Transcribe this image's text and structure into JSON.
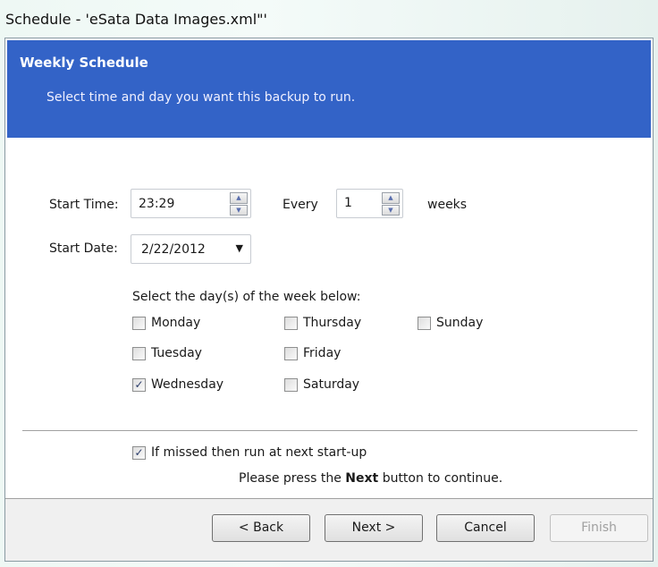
{
  "window": {
    "title": "Schedule -  'eSata Data Images.xml\"'"
  },
  "header": {
    "title": "Weekly Schedule",
    "subtitle": "Select time and day you want this backup to run."
  },
  "form": {
    "start_time_label": "Start Time:",
    "start_time_value": "23:29",
    "every_label": "Every",
    "every_value": "1",
    "weeks_label": "weeks",
    "start_date_label": "Start Date:",
    "start_date_value": "2/22/2012",
    "days_prompt": "Select the day(s) of the week below:",
    "days": [
      {
        "label": "Monday",
        "checked": false
      },
      {
        "label": "Tuesday",
        "checked": false
      },
      {
        "label": "Wednesday",
        "checked": true
      },
      {
        "label": "Thursday",
        "checked": false
      },
      {
        "label": "Friday",
        "checked": false
      },
      {
        "label": "Saturday",
        "checked": false
      },
      {
        "label": "Sunday",
        "checked": false
      }
    ],
    "missed_label": "If missed then run at next start-up",
    "missed_checked": true,
    "hint_pre": "Please press the",
    "hint_bold": "Next",
    "hint_post": "button to continue."
  },
  "buttons": {
    "back": "< Back",
    "next": "Next >",
    "cancel": "Cancel",
    "finish": "Finish"
  },
  "icons": {
    "spin": "up-down-arrows",
    "dropdown": "triangle-down",
    "check": "✓"
  }
}
